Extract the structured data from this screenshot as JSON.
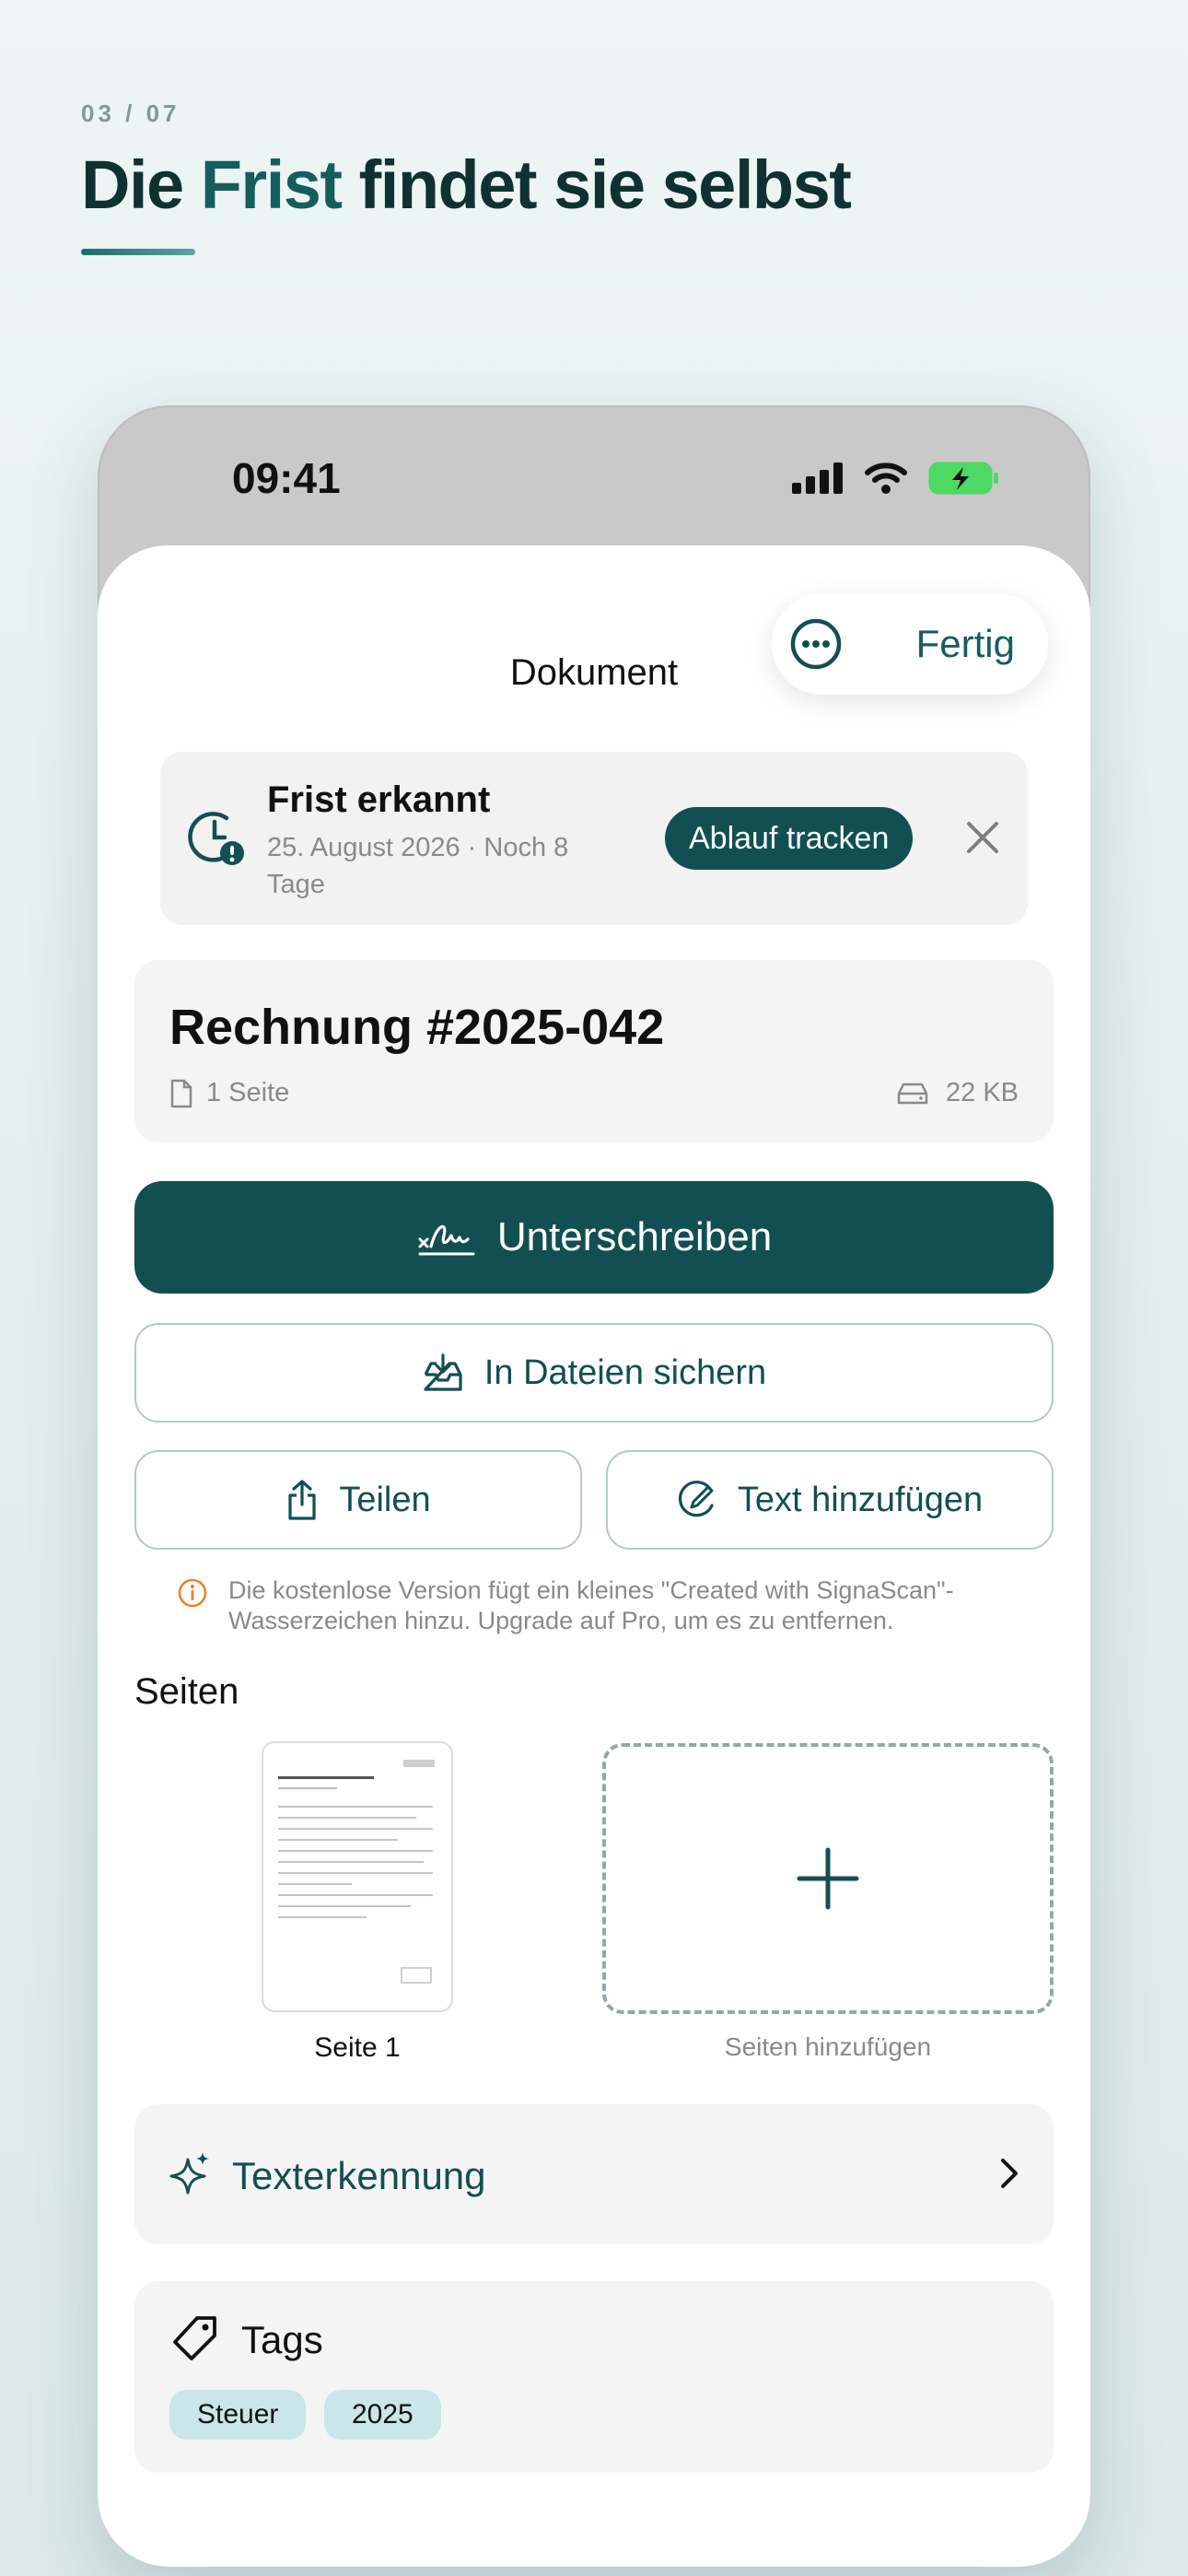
{
  "promo": {
    "step": "03 / 07",
    "headline_pre": "Die ",
    "headline_accent": "Frist",
    "headline_post": " findet sie selbst"
  },
  "status_bar": {
    "time": "09:41",
    "battery": "charging"
  },
  "nav": {
    "title": "Dokument",
    "done_label": "Fertig",
    "more_icon": "ellipsis-circle-icon"
  },
  "deadline_banner": {
    "icon": "clock-alert-icon",
    "title": "Frist erkannt",
    "subtitle": "25. August 2026 · Noch 8 Tage",
    "track_label": "Ablauf tracken",
    "close_icon": "close-icon"
  },
  "document": {
    "title": "Rechnung #2025-042",
    "pages": "1 Seite",
    "size": "22 KB"
  },
  "actions": {
    "sign_label": "Unterschreiben",
    "save_files_label": "In Dateien sichern",
    "share_label": "Teilen",
    "add_text_label": "Text hinzufügen"
  },
  "notice": {
    "text": "Die kostenlose Version fügt ein kleines \"Created with SignaScan\"-Wasserzeichen hinzu. Upgrade auf Pro, um es zu entfernen."
  },
  "pages_section": {
    "title": "Seiten",
    "pages": [
      {
        "label": "Seite 1"
      }
    ],
    "add_label": "Seiten hinzufügen"
  },
  "ocr": {
    "label": "Texterkennung"
  },
  "tags": {
    "title": "Tags",
    "items": [
      "Steuer",
      "2025"
    ]
  },
  "colors": {
    "accent": "#124f53",
    "headline": "#0f3132",
    "tag_bg": "#c9e6ea",
    "warning": "#e5872b",
    "battery": "#4cd964"
  }
}
